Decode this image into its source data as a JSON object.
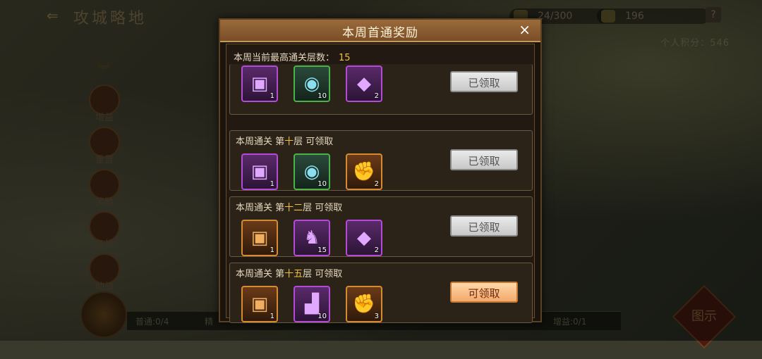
{
  "topbar": {
    "back_icon": "back-arrow-icon",
    "title": "攻城略地",
    "resource1": "24/300",
    "resource2": "196",
    "help": "?"
  },
  "score": "个人积分：546",
  "side_buttons": [
    "增益",
    "重置",
    "奖励",
    "备战",
    "助战"
  ],
  "bottom": {
    "left": "普通:0/4",
    "mid": "精",
    "right": "增益:0/1"
  },
  "map_label": "图示",
  "modal": {
    "title": "本周首通奖励",
    "close": "×",
    "header_label": "本周当前最高通关层数：",
    "header_value": "15",
    "rows": [
      {
        "label_pre": "",
        "label_lv": "",
        "label_post": "",
        "items": [
          {
            "icon": "purple-chest-icon",
            "glyph": "▣",
            "count": "1",
            "quality": "purple"
          },
          {
            "icon": "crystal-orb-icon",
            "glyph": "◉",
            "count": "10",
            "quality": "green"
          },
          {
            "icon": "gold-token-icon",
            "glyph": "◆",
            "count": "2",
            "quality": "purple"
          }
        ],
        "button": "已领取",
        "claimed": true
      },
      {
        "label_pre": "本周通关 第",
        "label_lv": "十",
        "label_post": "层  可领取",
        "items": [
          {
            "icon": "purple-chest-icon",
            "glyph": "▣",
            "count": "1",
            "quality": "purple"
          },
          {
            "icon": "crystal-orb-icon",
            "glyph": "◉",
            "count": "10",
            "quality": "green"
          },
          {
            "icon": "red-banner-icon",
            "glyph": "✊",
            "count": "2",
            "quality": "orange"
          }
        ],
        "button": "已领取",
        "claimed": true
      },
      {
        "label_pre": "本周通关 第",
        "label_lv": "十二",
        "label_post": "层  可领取",
        "items": [
          {
            "icon": "orange-chest-icon",
            "glyph": "▣",
            "count": "1",
            "quality": "orange"
          },
          {
            "icon": "horse-icon",
            "glyph": "♞",
            "count": "15",
            "quality": "purple"
          },
          {
            "icon": "gold-token-icon",
            "glyph": "◆",
            "count": "2",
            "quality": "purple"
          }
        ],
        "button": "已领取",
        "claimed": true
      },
      {
        "label_pre": "本周通关 第",
        "label_lv": "十五",
        "label_post": "层  可领取",
        "items": [
          {
            "icon": "orange-chest-icon",
            "glyph": "▣",
            "count": "1",
            "quality": "orange"
          },
          {
            "icon": "seal-stamp-icon",
            "glyph": "▟",
            "count": "10",
            "quality": "purple"
          },
          {
            "icon": "red-banner-icon",
            "glyph": "✊",
            "count": "3",
            "quality": "orange"
          }
        ],
        "button": "可领取",
        "claimed": false
      }
    ]
  }
}
